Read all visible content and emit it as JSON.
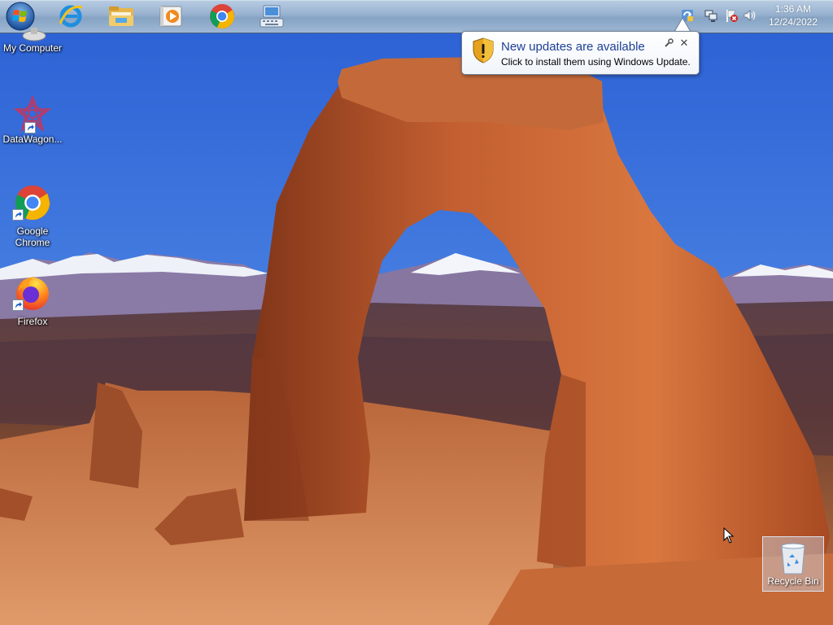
{
  "taskbar": {
    "items": [
      {
        "name": "start-orb",
        "icon": "windows-logo-icon"
      },
      {
        "name": "internet-explorer",
        "icon": "internet-explorer-icon"
      },
      {
        "name": "file-explorer",
        "icon": "folder-icon"
      },
      {
        "name": "media-player",
        "icon": "media-player-icon"
      },
      {
        "name": "google-chrome",
        "icon": "chrome-icon"
      },
      {
        "name": "on-screen-keyboard",
        "icon": "keyboard-icon"
      }
    ],
    "tray": {
      "icons": [
        "windows-update-icon",
        "network-icon",
        "action-center-flag-icon",
        "volume-icon"
      ],
      "time": "1:36 AM",
      "date": "12/24/2022"
    }
  },
  "notification": {
    "title": "New updates are available",
    "text": "Click to install them using Windows Update."
  },
  "desktop": {
    "icons": [
      {
        "label": "My Computer",
        "icon": "computer-icon"
      },
      {
        "label": "DataWagon...",
        "icon": "datawagon-icon"
      },
      {
        "label": "Google Chrome",
        "icon": "chrome-icon"
      },
      {
        "label": "Firefox",
        "icon": "firefox-icon"
      },
      {
        "label": "Recycle Bin",
        "icon": "recycle-bin-icon"
      }
    ]
  },
  "colors": {
    "sky": "#3a70dc",
    "rock": "#b8522a",
    "taskbar": "#97b1cf",
    "balloon_title": "#1c3f95"
  }
}
